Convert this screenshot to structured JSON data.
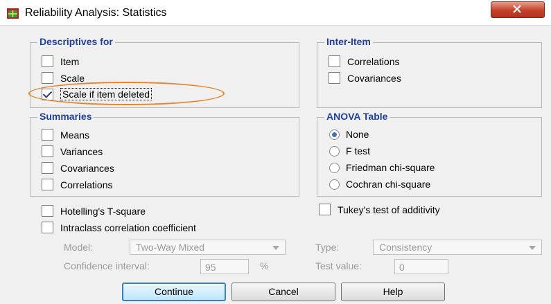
{
  "window": {
    "title": "Reliability Analysis: Statistics"
  },
  "descriptives": {
    "title": "Descriptives for",
    "items": [
      {
        "label": "Item",
        "checked": false
      },
      {
        "label": "Scale",
        "checked": false
      },
      {
        "label": "Scale if item deleted",
        "checked": true
      }
    ]
  },
  "inter_item": {
    "title": "Inter-Item",
    "items": [
      {
        "label": "Correlations",
        "checked": false
      },
      {
        "label": "Covariances",
        "checked": false
      }
    ]
  },
  "summaries": {
    "title": "Summaries",
    "items": [
      {
        "label": "Means",
        "checked": false
      },
      {
        "label": "Variances",
        "checked": false
      },
      {
        "label": "Covariances",
        "checked": false
      },
      {
        "label": "Correlations",
        "checked": false
      }
    ]
  },
  "anova": {
    "title": "ANOVA Table",
    "options": [
      {
        "label": "None",
        "selected": true
      },
      {
        "label": "F test",
        "selected": false
      },
      {
        "label": "Friedman chi-square",
        "selected": false
      },
      {
        "label": "Cochran chi-square",
        "selected": false
      }
    ]
  },
  "extra": {
    "hotelling": {
      "label": "Hotelling's T-square",
      "checked": false
    },
    "tukey": {
      "label": "Tukey's test of additivity",
      "checked": false
    },
    "intraclass": {
      "label": "Intraclass correlation coefficient",
      "checked": false
    }
  },
  "icc": {
    "model_label": "Model:",
    "model_value": "Two-Way Mixed",
    "type_label": "Type:",
    "type_value": "Consistency",
    "ci_label": "Confidence interval:",
    "ci_value": "95",
    "ci_unit": "%",
    "test_label": "Test value:",
    "test_value": "0"
  },
  "buttons": {
    "continue": "Continue",
    "cancel": "Cancel",
    "help": "Help"
  },
  "colors": {
    "group_title": "#1f3f9f",
    "highlight": "#e8832a",
    "close_button": "#c4402a"
  },
  "icons": {
    "app": "spss-grid-icon",
    "close": "close-icon"
  }
}
